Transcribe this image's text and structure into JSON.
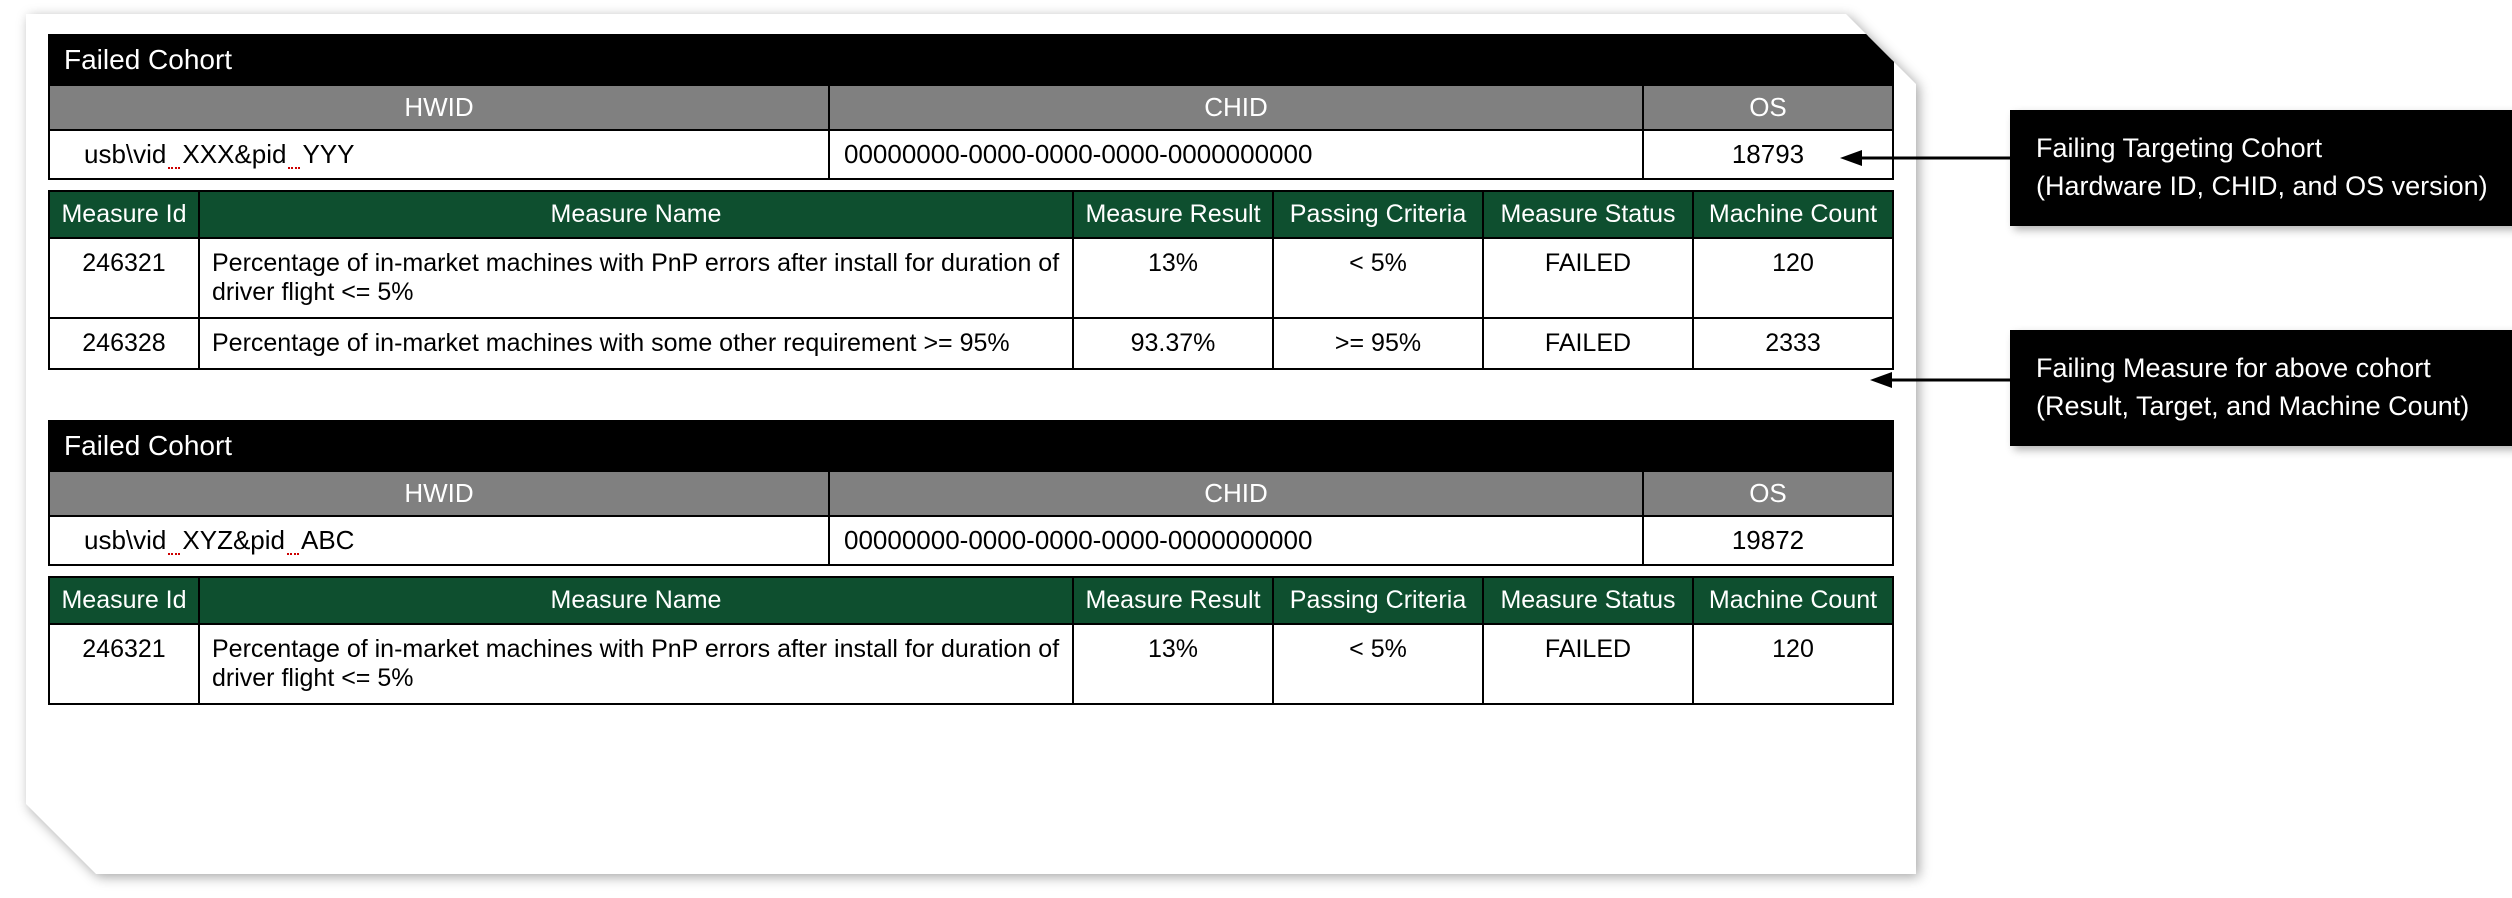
{
  "cohorts": [
    {
      "title": "Failed Cohort",
      "headers": {
        "hwid": "HWID",
        "chid": "CHID",
        "os": "OS"
      },
      "row": {
        "hwid_prefix": "usb\\vid",
        "hwid_mid": "XXX&pid",
        "hwid_suffix": "YYY",
        "chid": "00000000-0000-0000-0000-0000000000",
        "os": "18793"
      },
      "mheaders": {
        "id": "Measure Id",
        "name": "Measure Name",
        "result": "Measure Result",
        "criteria": "Passing Criteria",
        "status": "Measure Status",
        "count": "Machine Count"
      },
      "measures": [
        {
          "id": "246321",
          "name": "Percentage of in-market machines with PnP errors after install for duration of driver flight <= 5%",
          "result": "13%",
          "criteria": "< 5%",
          "status": "FAILED",
          "count": "120"
        },
        {
          "id": "246328",
          "name": "Percentage of in-market machines with some other requirement >= 95%",
          "result": "93.37%",
          "criteria": ">= 95%",
          "status": "FAILED",
          "count": "2333"
        }
      ]
    },
    {
      "title": "Failed Cohort",
      "headers": {
        "hwid": "HWID",
        "chid": "CHID",
        "os": "OS"
      },
      "row": {
        "hwid_prefix": "usb\\vid",
        "hwid_mid": "XYZ&pid",
        "hwid_suffix": "ABC",
        "chid": "00000000-0000-0000-0000-0000000000",
        "os": "19872"
      },
      "mheaders": {
        "id": "Measure Id",
        "name": "Measure Name",
        "result": "Measure Result",
        "criteria": "Passing Criteria",
        "status": "Measure Status",
        "count": "Machine Count"
      },
      "measures": [
        {
          "id": "246321",
          "name": "Percentage of in-market machines with PnP errors after install for duration of driver flight <= 5%",
          "result": "13%",
          "criteria": "< 5%",
          "status": "FAILED",
          "count": "120"
        }
      ]
    }
  ],
  "callouts": {
    "c1": {
      "line1": "Failing Targeting Cohort",
      "line2": "(Hardware ID, CHID, and OS version)"
    },
    "c2": {
      "line1": "Failing Measure for above cohort",
      "line2": "(Result, Target, and Machine Count)"
    }
  }
}
